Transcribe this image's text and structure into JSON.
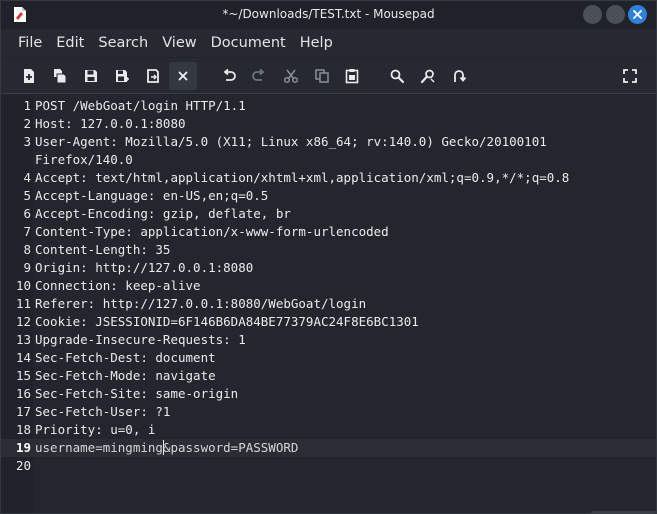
{
  "window": {
    "title": "*~/Downloads/TEST.txt - Mousepad"
  },
  "menubar": {
    "items": [
      "File",
      "Edit",
      "Search",
      "View",
      "Document",
      "Help"
    ]
  },
  "toolbar": {
    "buttons": [
      {
        "icon": "new-document-icon"
      },
      {
        "icon": "open-document-icon"
      },
      {
        "icon": "save-icon"
      },
      {
        "icon": "save-as-icon"
      },
      {
        "icon": "reload-icon"
      },
      {
        "icon": "close-tab-icon"
      },
      {
        "icon": "undo-icon"
      },
      {
        "icon": "redo-icon"
      },
      {
        "icon": "cut-icon"
      },
      {
        "icon": "copy-icon"
      },
      {
        "icon": "paste-icon"
      },
      {
        "icon": "search-icon"
      },
      {
        "icon": "find-replace-icon"
      },
      {
        "icon": "go-to-line-icon"
      },
      {
        "icon": "fullscreen-icon"
      }
    ]
  },
  "editor": {
    "current_line": 19,
    "lines": [
      {
        "n": "1",
        "text": "POST /WebGoat/login HTTP/1.1"
      },
      {
        "n": "2",
        "text": "Host: 127.0.0.1:8080"
      },
      {
        "n": "3",
        "text": "User-Agent: Mozilla/5.0 (X11; Linux x86_64; rv:140.0) Gecko/20100101"
      },
      {
        "n": "",
        "text": "Firefox/140.0"
      },
      {
        "n": "4",
        "text": "Accept: text/html,application/xhtml+xml,application/xml;q=0.9,*/*;q=0.8"
      },
      {
        "n": "5",
        "text": "Accept-Language: en-US,en;q=0.5"
      },
      {
        "n": "6",
        "text": "Accept-Encoding: gzip, deflate, br"
      },
      {
        "n": "7",
        "text": "Content-Type: application/x-www-form-urlencoded"
      },
      {
        "n": "8",
        "text": "Content-Length: 35"
      },
      {
        "n": "9",
        "text": "Origin: http://127.0.0.1:8080"
      },
      {
        "n": "10",
        "text": "Connection: keep-alive"
      },
      {
        "n": "11",
        "text": "Referer: http://127.0.0.1:8080/WebGoat/login"
      },
      {
        "n": "12",
        "text": "Cookie: JSESSIONID=6F146B6DA84BE77379AC24F8E6BC1301"
      },
      {
        "n": "13",
        "text": "Upgrade-Insecure-Requests: 1"
      },
      {
        "n": "14",
        "text": "Sec-Fetch-Dest: document"
      },
      {
        "n": "15",
        "text": "Sec-Fetch-Mode: navigate"
      },
      {
        "n": "16",
        "text": "Sec-Fetch-Site: same-origin"
      },
      {
        "n": "17",
        "text": "Sec-Fetch-User: ?1"
      },
      {
        "n": "18",
        "text": "Priority: u=0, i"
      },
      {
        "n": "19",
        "text_before_caret": "username=mingming",
        "text_after_caret": "&password=PASSWORD"
      },
      {
        "n": "20",
        "text": ""
      }
    ]
  },
  "colors": {
    "background": "#23262d",
    "accent": "#2f80d8",
    "text": "#e9ebee"
  }
}
